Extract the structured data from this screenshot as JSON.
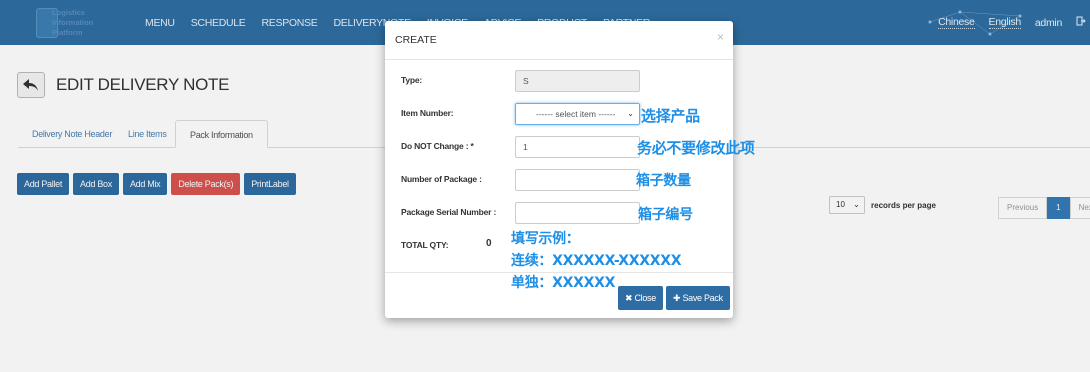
{
  "header": {
    "logo_lines": [
      "Logistics",
      "Information",
      "Platform"
    ],
    "nav": [
      "MENU",
      "SCHEDULE",
      "RESPONSE",
      "DELIVERYNOTE",
      "INVOICE",
      "ADVICE",
      "PRODUCT",
      "PARTNER"
    ],
    "lang_chinese": "Chinese",
    "lang_english": "English",
    "user": "admin",
    "logout_icon": "logout-icon"
  },
  "page": {
    "title": "EDIT DELIVERY NOTE",
    "tabs": [
      "Delivery Note Header",
      "Line Items",
      "Pack Information"
    ],
    "active_tab": "Pack Information",
    "buttons": [
      "Add Pallet",
      "Add Box",
      "Add Mix",
      "Delete Pack(s)",
      "PrintLabel"
    ],
    "per_page_value": "10",
    "per_page_label": "records per page",
    "pager": {
      "previous": "Previous",
      "current": "1",
      "next": "Next"
    }
  },
  "modal": {
    "title": "CREATE",
    "close_glyph": "×",
    "fields": {
      "type_label": "Type:",
      "type_value": "S",
      "item_label": "Item Number:",
      "item_placeholder": "------ select item ------",
      "donot_label": "Do NOT Change : *",
      "donot_value": "1",
      "num_pkg_label": "Number of Package :",
      "num_pkg_value": "",
      "serial_label": "Package Serial Number :",
      "serial_value": "",
      "total_label": "TOTAL QTY:",
      "total_value": "0"
    },
    "close_button": "Close",
    "save_button": "Save Pack"
  },
  "annotations": {
    "select_product": "选择产品",
    "do_not_change": "务必不要修改此项",
    "box_count": "箱子数量",
    "box_serial": "箱子编号",
    "example_title": "填写示例：",
    "example_range": "连续：XXXXXX-XXXXXX",
    "example_single": "单独：XXXXXX"
  },
  "colors": {
    "topbar": "#2f6fa3",
    "primary": "#2e6da4",
    "danger": "#d9534f",
    "annotation": "#1f8fe6"
  }
}
